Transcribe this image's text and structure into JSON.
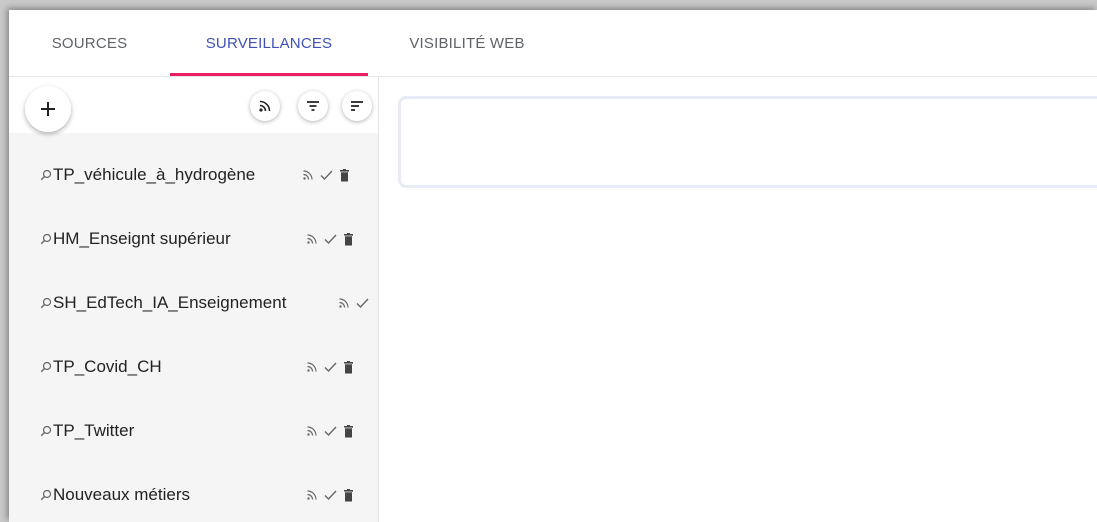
{
  "tabs": [
    {
      "label": "SOURCES",
      "active": false
    },
    {
      "label": "SURVEILLANCES",
      "active": true
    },
    {
      "label": "VISIBILITÉ WEB",
      "active": false
    }
  ],
  "toolbar": {
    "add_icon": "plus-icon",
    "feed_icon": "rss-icon",
    "filter_icon": "filter-icon",
    "sort_icon": "sort-icon"
  },
  "watches": [
    {
      "label": "TP_véhicule_à_hydrogène"
    },
    {
      "label": "HM_Enseignt supérieur"
    },
    {
      "label": "SH_EdTech_IA_Enseignement"
    },
    {
      "label": "TP_Covid_CH"
    },
    {
      "label": "TP_Twitter"
    },
    {
      "label": "Nouveaux métiers"
    }
  ],
  "colors": {
    "accent": "#3f51b5",
    "ink": "#e91e63",
    "icon": "#616161"
  }
}
